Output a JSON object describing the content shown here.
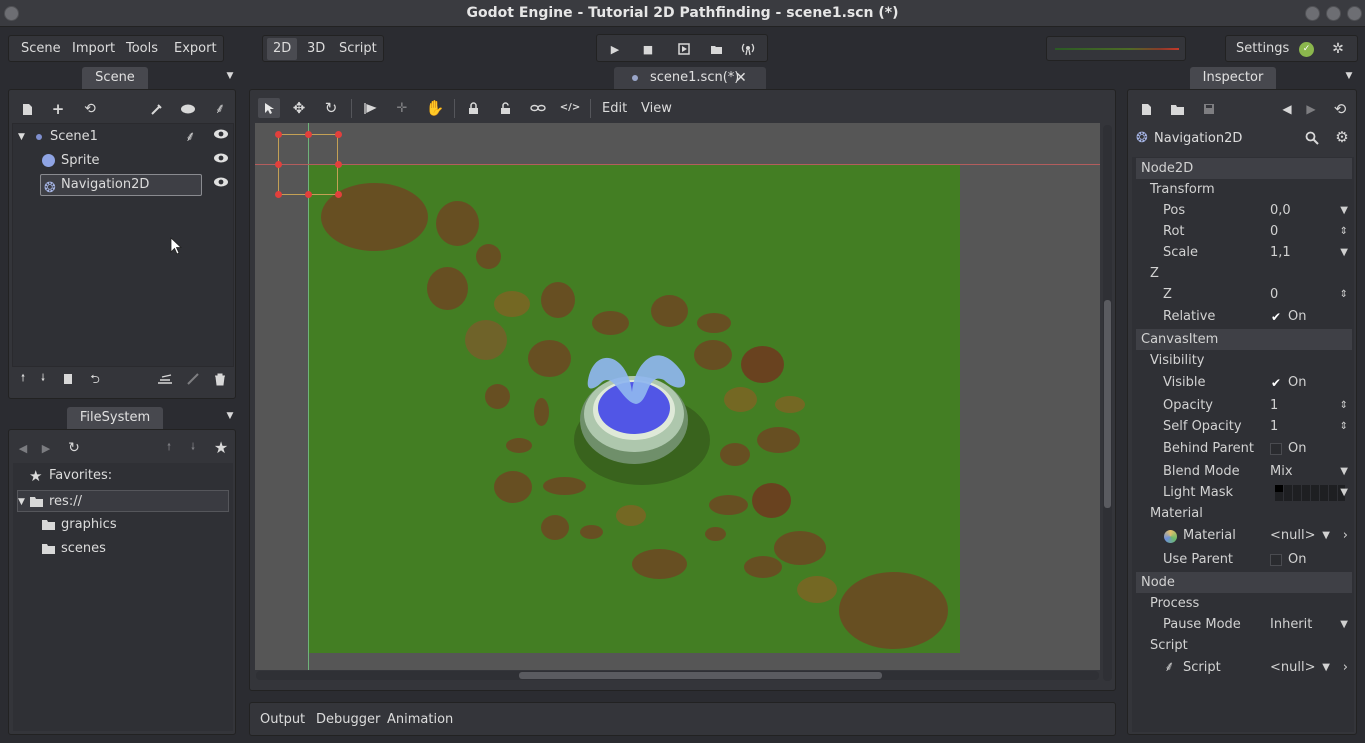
{
  "window": {
    "title": "Godot Engine - Tutorial 2D Pathfinding - scene1.scn (*)"
  },
  "menu": [
    "Scene",
    "Import",
    "Tools",
    "Export"
  ],
  "modes": [
    "2D",
    "3D",
    "Script"
  ],
  "settings_label": "Settings",
  "tabs": {
    "scene": "Scene",
    "document": "scene1.scn(*)",
    "inspector": "Inspector",
    "filesystem": "FileSystem"
  },
  "scene_tree": [
    {
      "label": "Scene1",
      "icon": "node-dot-icon"
    },
    {
      "label": "Sprite",
      "icon": "sprite-icon"
    },
    {
      "label": "Navigation2D",
      "icon": "navigation2d-icon"
    }
  ],
  "viewport_menu": {
    "edit": "Edit",
    "view": "View"
  },
  "filesystem": {
    "favorites": "Favorites:",
    "root": "res://",
    "folders": [
      "graphics",
      "scenes"
    ]
  },
  "bottom_tabs": [
    "Output",
    "Debugger",
    "Animation"
  ],
  "inspector": {
    "node_name": "Navigation2D",
    "sections": {
      "node2d": "Node2D",
      "transform": "Transform",
      "z_group": "Z",
      "canvasitem": "CanvasItem",
      "visibility": "Visibility",
      "material_group": "Material",
      "node": "Node",
      "process": "Process",
      "script_group": "Script"
    },
    "props": {
      "pos": {
        "label": "Pos",
        "value": "0,0"
      },
      "rot": {
        "label": "Rot",
        "value": "0"
      },
      "scale": {
        "label": "Scale",
        "value": "1,1"
      },
      "z": {
        "label": "Z",
        "value": "0"
      },
      "relative": {
        "label": "Relative",
        "value": "On"
      },
      "visible": {
        "label": "Visible",
        "value": "On"
      },
      "opacity": {
        "label": "Opacity",
        "value": "1"
      },
      "self_opacity": {
        "label": "Self Opacity",
        "value": "1"
      },
      "behind_parent": {
        "label": "Behind Parent",
        "value": "On"
      },
      "blend_mode": {
        "label": "Blend Mode",
        "value": "Mix"
      },
      "light_mask": {
        "label": "Light Mask"
      },
      "material": {
        "label": "Material",
        "value": "<null>"
      },
      "use_parent": {
        "label": "Use Parent",
        "value": "On"
      },
      "pause_mode": {
        "label": "Pause Mode",
        "value": "Inherit"
      },
      "script": {
        "label": "Script",
        "value": "<null>"
      }
    }
  },
  "colors": {
    "grass": "#437e23",
    "canvas_bg": "#565656",
    "accent": "#c3a055"
  }
}
